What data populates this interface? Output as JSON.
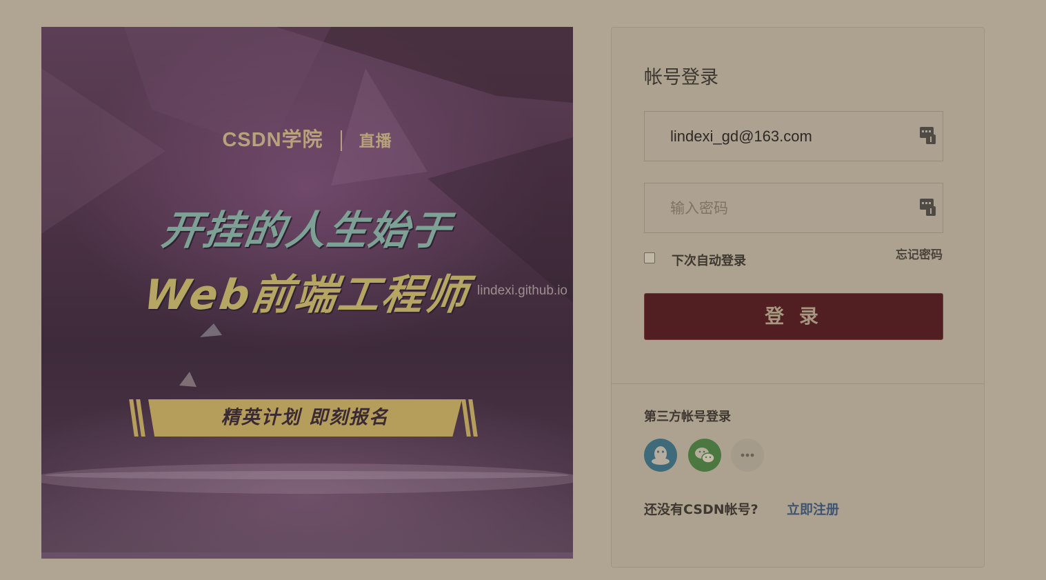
{
  "banner": {
    "brand_name": "CSDN学院",
    "brand_sub": "直播",
    "headline_line1": "开挂的人生始于",
    "headline_line2": "Web前端工程师",
    "ribbon_text": "精英计划  即刻报名",
    "watermark": "lindexi.github.io"
  },
  "login": {
    "title": "帐号登录",
    "username_value": "lindexi_gd@163.com",
    "password_placeholder": "输入密码",
    "remember_label": "下次自动登录",
    "forgot_label": "忘记密码",
    "login_button": "登 录",
    "third_party_title": "第三方帐号登录",
    "social_icons": [
      "qq-icon",
      "wechat-icon",
      "more-icon"
    ],
    "no_account_text": "还没有CSDN帐号?",
    "register_link": "立即注册"
  },
  "colors": {
    "page_background": "#b0a592",
    "login_button": "#511e21",
    "register_link": "#3f5471",
    "qq": "#3f6a7a",
    "wechat": "#4b7840"
  }
}
